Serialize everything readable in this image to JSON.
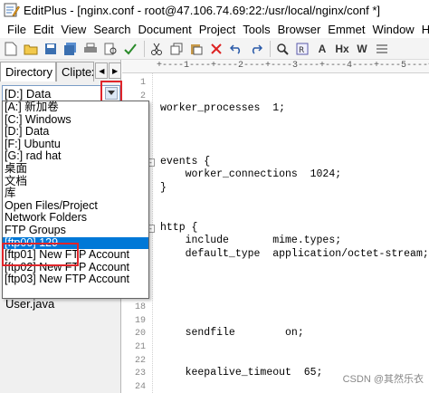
{
  "window": {
    "title": "EditPlus - [nginx.conf - root@47.106.74.69:22:/usr/local/nginx/conf *]"
  },
  "menu": [
    "File",
    "Edit",
    "View",
    "Search",
    "Document",
    "Project",
    "Tools",
    "Browser",
    "Emmet",
    "Window",
    "Help"
  ],
  "toolbar": {
    "text_buttons": {
      "h": "Hx",
      "w": "W",
      "a": "A"
    },
    "icons": [
      "new-icon",
      "open-icon",
      "save-icon",
      "save-all-icon",
      "print-icon",
      "print-preview-icon",
      "spell-check-icon",
      "cut-icon",
      "copy-icon",
      "paste-icon",
      "delete-icon",
      "undo-icon",
      "redo-icon",
      "find-icon",
      "replace-icon",
      "font-size-icon",
      "word-wrap-icon",
      "list-icon",
      "ruler-icon"
    ]
  },
  "left_panel": {
    "tabs": [
      "Directory",
      "Cliptex"
    ],
    "drive_select": {
      "value": "[D:] Data"
    },
    "drive_options": [
      "[A:] 新加卷",
      "[C:] Windows",
      "[D:] Data",
      "[F:] Ubuntu",
      "[G:] rad hat",
      "桌面",
      "文档",
      "库",
      "Open Files/Project",
      "Network Folders",
      "FTP Groups",
      "[ftp00] 129",
      "[ftp01] New FTP Account",
      "[ftp02] New FTP Account",
      "[ftp03] New FTP Account"
    ],
    "selected_option_index": 11,
    "partial_file": "User.java"
  },
  "editor": {
    "ruler": "+----1----+----2----+----3----+----4----+----5----+",
    "line_numbers": [
      "1",
      "2",
      "3",
      "4",
      "5",
      "6",
      "7",
      "8",
      "9",
      "10",
      "11",
      "12",
      "13",
      "14",
      "15",
      "16",
      "17",
      "18",
      "19",
      "20",
      "21",
      "22",
      "23",
      "24"
    ],
    "lines": [
      {
        "n": 3,
        "text": "worker_processes  1;"
      },
      {
        "n": 7,
        "text": "events {",
        "fold": true
      },
      {
        "n": 8,
        "text": "    worker_connections  1024;"
      },
      {
        "n": 9,
        "text": "}"
      },
      {
        "n": 12,
        "text": "http {",
        "fold": true
      },
      {
        "n": 13,
        "text": "    include       mime.types;"
      },
      {
        "n": 14,
        "text": "    default_type  application/octet-stream;"
      },
      {
        "n": 20,
        "text": "    sendfile        on;"
      },
      {
        "n": 23,
        "text": "    keepalive_timeout  65;"
      }
    ]
  },
  "watermark": "CSDN @其然乐衣"
}
